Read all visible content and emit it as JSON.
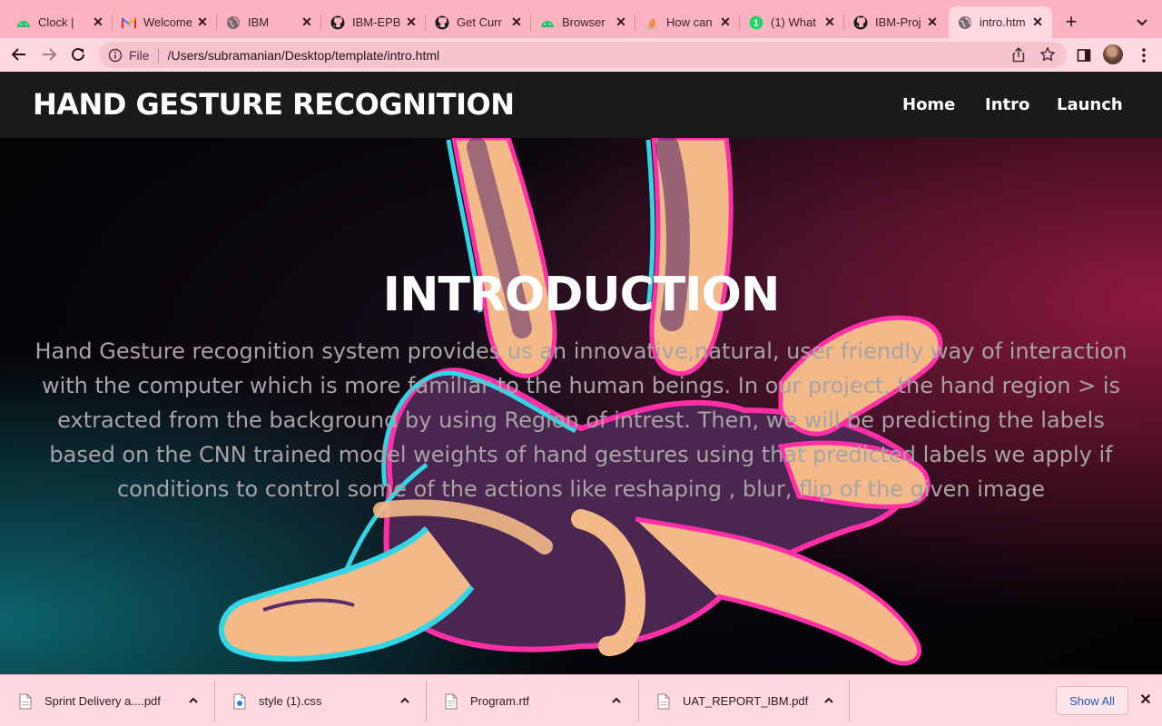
{
  "browser": {
    "tabs": [
      {
        "title": "Clock |",
        "icon": "android-green-icon",
        "active": false
      },
      {
        "title": "Welcome",
        "icon": "gmail-icon",
        "active": false
      },
      {
        "title": "IBM",
        "icon": "globe-icon",
        "active": false
      },
      {
        "title": "IBM-EPB",
        "icon": "github-icon",
        "active": false
      },
      {
        "title": "Get Curr",
        "icon": "github-icon",
        "active": false
      },
      {
        "title": "Browser",
        "icon": "android-green-icon",
        "active": false
      },
      {
        "title": "How can",
        "icon": "stackoverflow-icon",
        "active": false
      },
      {
        "title": "(1) What",
        "icon": "whatsapp-icon",
        "active": false
      },
      {
        "title": "IBM-Proj",
        "icon": "github-icon",
        "active": false
      },
      {
        "title": "intro.htm",
        "icon": "globe-icon",
        "active": true
      }
    ],
    "address": {
      "scheme_label": "File",
      "url": "/Users/subramanian/Desktop/template/intro.html"
    },
    "colors": {
      "tabstrip": "#fbb3c1",
      "toolbar": "#ffd9df",
      "omnibox": "#f5c4cd"
    }
  },
  "site": {
    "brand": "HAND GESTURE RECOGNITION",
    "nav": {
      "home": "Home",
      "intro": "Intro",
      "launch": "Launch"
    }
  },
  "hero": {
    "title": "INTRODUCTION",
    "text": "Hand Gesture recognition system provides us an innovative,natural, user friendly way of interaction with the computer which is more familiar to the human beings. In our project, the hand region > is extracted from the background by using Region of intrest. Then, we will be predicting the labels based on the CNN trained model weights of hand gestures using that predicted labels we apply if conditions to control some of the actions like reshaping , blur, flip of the given image"
  },
  "downloads": {
    "items": [
      {
        "name": "Sprint Delivery a....pdf",
        "icon": "pdf-file-icon"
      },
      {
        "name": "style (1).css",
        "icon": "css-file-icon"
      },
      {
        "name": "Program.rtf",
        "icon": "document-file-icon"
      },
      {
        "name": "UAT_REPORT_IBM.pdf",
        "icon": "pdf-file-icon"
      }
    ],
    "show_all": "Show All"
  }
}
